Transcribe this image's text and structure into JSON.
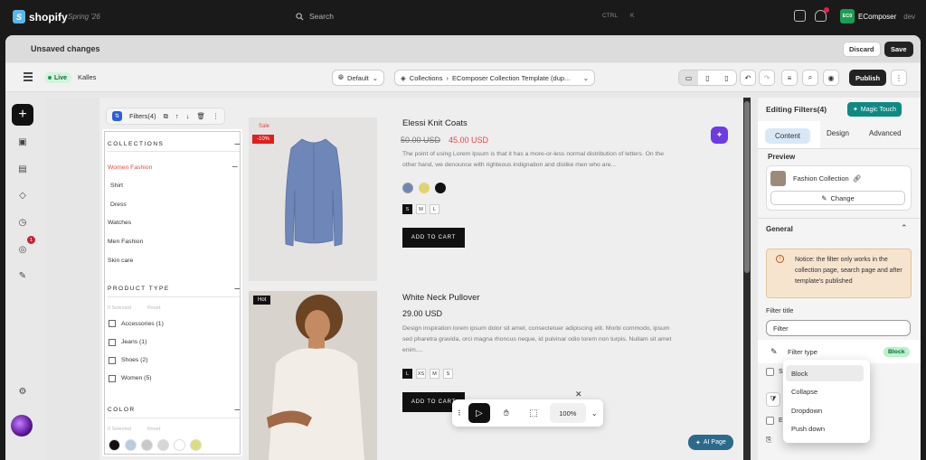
{
  "topbar": {
    "brand": "shopify",
    "edition": "Spring '26",
    "search_placeholder": "Search",
    "shortcut_ctrl": "CTRL",
    "shortcut_key": "K",
    "store_initials": "EC0",
    "store_name": "EComposer",
    "store_env": "dev",
    "notification_color": "#e11d48"
  },
  "savebar": {
    "title": "Unsaved changes",
    "discard_label": "Discard",
    "save_label": "Save"
  },
  "toolbar": {
    "status": "Live",
    "theme_name": "Kalles",
    "language": "Default",
    "breadcrumb_section": "Collections",
    "template_name": "EComposer Collection Template (dup...",
    "publish_label": "Publish"
  },
  "rail": {
    "notification_count": "1"
  },
  "element_bar": {
    "label": "Filters(4)"
  },
  "filters": {
    "collections_title": "COLLECTIONS",
    "collections": [
      {
        "label": "Women Fashion"
      },
      {
        "label": "Shirt"
      },
      {
        "label": "Dress"
      },
      {
        "label": "Watches"
      },
      {
        "label": "Men Fashion"
      },
      {
        "label": "Skin care"
      }
    ],
    "product_type_title": "PRODUCT TYPE",
    "selected_text": "0 Selected",
    "reset_text": "Reset",
    "product_types": [
      {
        "label": "Accessories (1)"
      },
      {
        "label": "Jeans (1)"
      },
      {
        "label": "Shoes (2)"
      },
      {
        "label": "Women (5)"
      }
    ],
    "color_title": "COLOR",
    "color_selected_text": "0 Selected",
    "color_reset_text": "Reset",
    "swatches": [
      "#111111",
      "#b8cce0",
      "#c8c8c8",
      "#d6d6d6",
      "#ffffff",
      "#dedd7e"
    ]
  },
  "products": [
    {
      "badge": "Sale",
      "discount": "-10%",
      "title": "Elessi Knit Coats",
      "old_price": "50.00 USD",
      "price": "45.00 USD",
      "description": "The point of using Lorem Ipsum is that it has a more-or-less normal distribution of letters. On the other hand, we denounce with righteous indignation and dislike men who are...",
      "sizes": [
        "S",
        "M",
        "L"
      ],
      "cart_label": "ADD TO CART"
    },
    {
      "badge": "Hot",
      "title": "White Neck Pullover",
      "price": "29.00 USD",
      "description": "Design inspiration lorem ipsum dolor sit amet, consectetuer adipiscing elit. Morbi commodo, ipsum sed pharetra gravida, orci magna rhoncus neque, id pulvinar odio lorem non turpis. Nullam sit amet enim....",
      "sizes": [
        "L",
        "XS",
        "M",
        "S"
      ],
      "cart_label": "ADD TO CART"
    }
  ],
  "floatbar": {
    "zoom": "100%",
    "ai_label": "AI Page"
  },
  "panel": {
    "title": "Editing Filters(4)",
    "magic_label": "Magic Touch",
    "tabs": [
      {
        "label": "Content"
      },
      {
        "label": "Design"
      },
      {
        "label": "Advanced"
      }
    ],
    "preview_title": "Preview",
    "preview_collection": "Fashion Collection",
    "change_label": "Change",
    "general_title": "General",
    "notice": "Notice: the filter only works in the collection page, search page and after template's published",
    "filter_title_label": "Filter title",
    "filter_title_value": "Filter",
    "filter_type_label": "Filter type",
    "filter_type_value": "Block",
    "truncated_s": "S",
    "truncated_e": "E",
    "options": [
      {
        "label": "Block"
      },
      {
        "label": "Collapse"
      },
      {
        "label": "Dropdown"
      },
      {
        "label": "Push down"
      }
    ]
  }
}
